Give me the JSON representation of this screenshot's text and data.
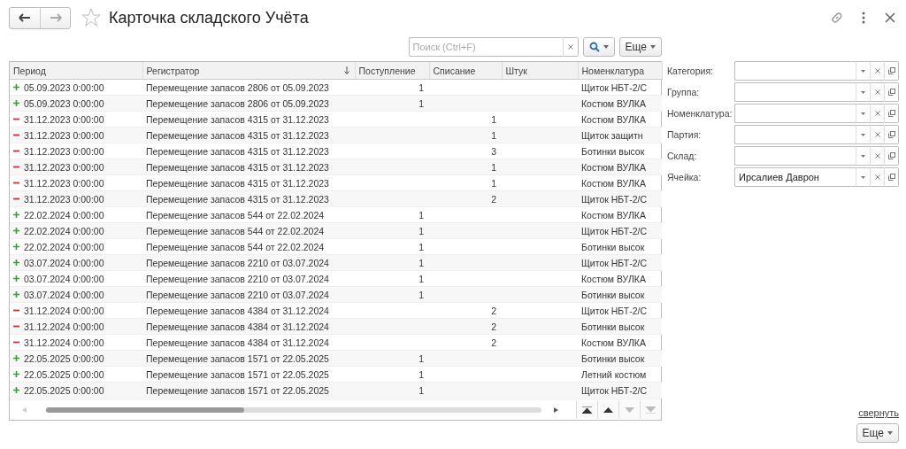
{
  "window": {
    "title": "Карточка складского Учёта",
    "favorite": false
  },
  "toolbar": {
    "search_placeholder": "Поиск (Ctrl+F)",
    "more_button": "Еще"
  },
  "table": {
    "columns": [
      {
        "label": "Период",
        "sorted": false
      },
      {
        "label": "Регистратор",
        "sorted": true
      },
      {
        "label": "Поступление",
        "sorted": false
      },
      {
        "label": "Списание",
        "sorted": false
      },
      {
        "label": "Штук",
        "sorted": false
      },
      {
        "label": "Номенклатура",
        "sorted": false
      }
    ],
    "rows": [
      {
        "kind": "in",
        "period": "05.09.2023 0:00:00",
        "registrar": "Перемещение запасов 2806 от 05.09.2023",
        "in": "1",
        "item": "Щиток НБТ-2/С"
      },
      {
        "kind": "in",
        "period": "05.09.2023 0:00:00",
        "registrar": "Перемещение запасов 2806 от 05.09.2023",
        "in": "1",
        "item": "Костюм ВУЛКА"
      },
      {
        "kind": "out",
        "period": "31.12.2023 0:00:00",
        "registrar": "Перемещение запасов 4315 от 31.12.2023",
        "out": "1",
        "item": "Костюм ВУЛКА"
      },
      {
        "kind": "out",
        "period": "31.12.2023 0:00:00",
        "registrar": "Перемещение запасов 4315 от 31.12.2023",
        "out": "1",
        "item": "Щиток защитн"
      },
      {
        "kind": "out",
        "period": "31.12.2023 0:00:00",
        "registrar": "Перемещение запасов 4315 от 31.12.2023",
        "out": "3",
        "item": "Ботинки высок"
      },
      {
        "kind": "out",
        "period": "31.12.2023 0:00:00",
        "registrar": "Перемещение запасов 4315 от 31.12.2023",
        "out": "1",
        "item": "Костюм ВУЛКА"
      },
      {
        "kind": "out",
        "period": "31.12.2023 0:00:00",
        "registrar": "Перемещение запасов 4315 от 31.12.2023",
        "out": "1",
        "item": "Костюм ВУЛКА"
      },
      {
        "kind": "out",
        "period": "31.12.2023 0:00:00",
        "registrar": "Перемещение запасов 4315 от 31.12.2023",
        "out": "2",
        "item": "Щиток НБТ-2/С"
      },
      {
        "kind": "in",
        "period": "22.02.2024 0:00:00",
        "registrar": "Перемещение запасов 544 от 22.02.2024",
        "in": "1",
        "item": "Костюм ВУЛКА"
      },
      {
        "kind": "in",
        "period": "22.02.2024 0:00:00",
        "registrar": "Перемещение запасов 544 от 22.02.2024",
        "in": "1",
        "item": "Щиток НБТ-2/С"
      },
      {
        "kind": "in",
        "period": "22.02.2024 0:00:00",
        "registrar": "Перемещение запасов 544 от 22.02.2024",
        "in": "1",
        "item": "Ботинки высок"
      },
      {
        "kind": "in",
        "period": "03.07.2024 0:00:00",
        "registrar": "Перемещение запасов 2210 от 03.07.2024",
        "in": "1",
        "item": "Щиток НБТ-2/С"
      },
      {
        "kind": "in",
        "period": "03.07.2024 0:00:00",
        "registrar": "Перемещение запасов 2210 от 03.07.2024",
        "in": "1",
        "item": "Костюм ВУЛКА"
      },
      {
        "kind": "in",
        "period": "03.07.2024 0:00:00",
        "registrar": "Перемещение запасов 2210 от 03.07.2024",
        "in": "1",
        "item": "Ботинки высок"
      },
      {
        "kind": "out",
        "period": "31.12.2024 0:00:00",
        "registrar": "Перемещение запасов 4384 от 31.12.2024",
        "out": "2",
        "item": "Щиток НБТ-2/С"
      },
      {
        "kind": "out",
        "period": "31.12.2024 0:00:00",
        "registrar": "Перемещение запасов 4384 от 31.12.2024",
        "out": "2",
        "item": "Ботинки высок"
      },
      {
        "kind": "out",
        "period": "31.12.2024 0:00:00",
        "registrar": "Перемещение запасов 4384 от 31.12.2024",
        "out": "2",
        "item": "Костюм ВУЛКА"
      },
      {
        "kind": "in",
        "period": "22.05.2025 0:00:00",
        "registrar": "Перемещение запасов 1571 от 22.05.2025",
        "in": "1",
        "item": "Ботинки высок"
      },
      {
        "kind": "in",
        "period": "22.05.2025 0:00:00",
        "registrar": "Перемещение запасов 1571 от 22.05.2025",
        "in": "1",
        "item": "Летний костюм"
      },
      {
        "kind": "in",
        "period": "22.05.2025 0:00:00",
        "registrar": "Перемещение запасов 1571 от 22.05.2025",
        "in": "1",
        "item": "Щиток НБТ-2/С"
      }
    ]
  },
  "filters": [
    {
      "label": "Категория:"
    },
    {
      "label": "Группа:"
    },
    {
      "label": "Номенклатура:"
    },
    {
      "label": "Партия:"
    },
    {
      "label": "Склад:"
    },
    {
      "label": "Ячейка:",
      "value": "Ирсалиев Даврон"
    }
  ],
  "collapse_link": "свернуть",
  "footer_more_button": "Еще"
}
